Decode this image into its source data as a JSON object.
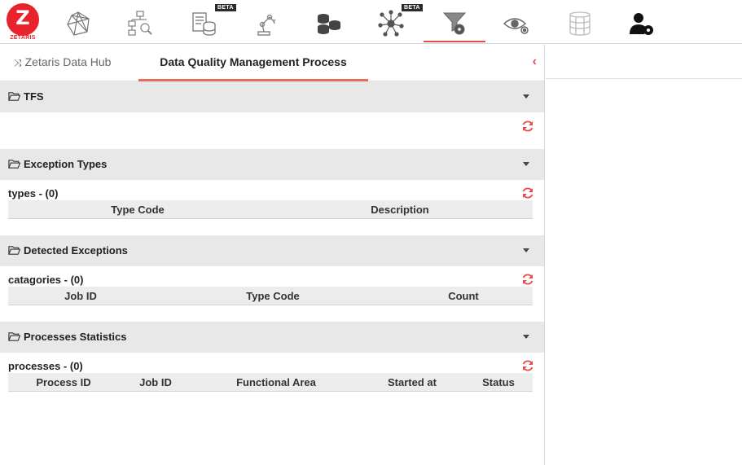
{
  "logo": {
    "letter": "Z",
    "brand": "ZETARIS"
  },
  "nav": {
    "icons": [
      {
        "name": "network-graph-icon",
        "beta": ""
      },
      {
        "name": "workflow-search-icon",
        "beta": ""
      },
      {
        "name": "document-database-icon",
        "beta": "BETA"
      },
      {
        "name": "robot-arm-icon",
        "beta": ""
      },
      {
        "name": "database-stack-icon",
        "beta": ""
      },
      {
        "name": "node-network-icon",
        "beta": "BETA"
      },
      {
        "name": "funnel-gear-icon",
        "beta": ""
      },
      {
        "name": "eye-gear-icon",
        "beta": ""
      },
      {
        "name": "server-stack-icon",
        "beta": ""
      },
      {
        "name": "user-settings-icon",
        "beta": ""
      }
    ]
  },
  "tabs": {
    "hub": "Zetaris Data Hub",
    "dq": "Data Quality Management Process"
  },
  "sections": {
    "tfs": {
      "title": "TFS"
    },
    "exception_types": {
      "title": "Exception Types",
      "list_title": "types - (0)",
      "columns": [
        "Type Code",
        "Description"
      ]
    },
    "detected_exceptions": {
      "title": "Detected Exceptions",
      "list_title": "catagories - (0)",
      "columns": [
        "Job ID",
        "Type Code",
        "Count"
      ]
    },
    "processes_statistics": {
      "title": "Processes Statistics",
      "list_title": "processes - (0)",
      "columns": [
        "Process ID",
        "Job ID",
        "Functional Area",
        "Started at",
        "Status"
      ]
    }
  },
  "colors": {
    "accent": "#e84a4a",
    "brand": "#e8232c",
    "header_bg": "#e8e8e8"
  }
}
